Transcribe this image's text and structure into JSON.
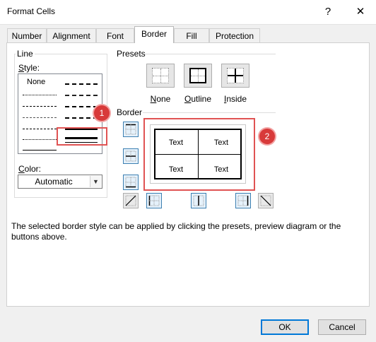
{
  "window": {
    "title": "Format Cells",
    "help_glyph": "?",
    "close_glyph": "✕"
  },
  "tabs": [
    {
      "label": "Number"
    },
    {
      "label": "Alignment"
    },
    {
      "label": "Font"
    },
    {
      "label": "Border",
      "active": true
    },
    {
      "label": "Fill"
    },
    {
      "label": "Protection"
    }
  ],
  "line_group": {
    "title": "Line",
    "style_label": "Style:",
    "style_none": "None",
    "color_label": "Color:",
    "color_value": "Automatic"
  },
  "presets": {
    "title": "Presets",
    "items": [
      {
        "label": "None",
        "mnemonic": "N",
        "rest": "one"
      },
      {
        "label": "Outline",
        "mnemonic": "O",
        "rest": "utline"
      },
      {
        "label": "Inside",
        "mnemonic": "I",
        "rest": "nside"
      }
    ]
  },
  "border": {
    "title": "Border",
    "preview_cells": [
      "Text",
      "Text",
      "Text",
      "Text"
    ]
  },
  "callouts": [
    "1",
    "2"
  ],
  "hint": "The selected border style can be applied by clicking the presets, preview diagram or the buttons above.",
  "buttons": {
    "ok": "OK",
    "cancel": "Cancel"
  },
  "colors": {
    "callout": "#d83a3a",
    "accent": "#0078d7"
  }
}
